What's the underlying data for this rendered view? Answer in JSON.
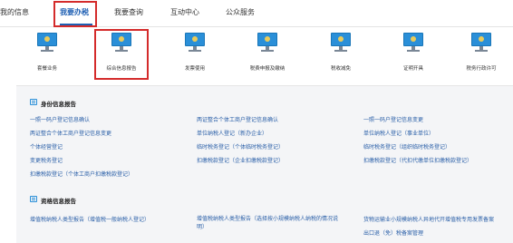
{
  "topnav": {
    "tabs": [
      "我的信息",
      "我要办税",
      "我要查询",
      "互动中心",
      "公众服务"
    ]
  },
  "icons": [
    "套餐业务",
    "综合信息报告",
    "发票使用",
    "税费申报及缴纳",
    "税收减免",
    "证明开具",
    "税务行政许可"
  ],
  "sections": {
    "identity": {
      "title": "身份信息报告",
      "links": [
        "一照一码户登记信息确认",
        "两证整合个体工商户登记信息确认",
        "一照一码户登记信息变更",
        "两证整合个体工商户登记信息变更",
        "单位纳税人登记（新办企业）",
        "单位纳税人登记（事业单位）",
        "个体经营登记",
        "临时税务登记（个体临时税务登记）",
        "临时税务登记（组织临时税务登记）",
        "变更税务登记",
        "扣缴税款登记（企业扣缴税款登记）",
        "扣缴税款登记（代扣代缴单位扣缴税款登记）",
        "扣缴税款登记（个体工商户扣缴税款登记）"
      ]
    },
    "qualification": {
      "title": "资格信息报告",
      "links": [
        "增值税纳税人类型报告（增值税一般纳税人登记）",
        "增值税纳税人类型报告（选择按小规模纳税人纳税的情况说明）",
        "货物运输业小规模纳税人异地代开增值税专用发票备案",
        "出口退（免）税备案管理"
      ]
    }
  },
  "colors": {
    "accent": "#1e5fb3",
    "highlight": "#d42b2b",
    "link": "#2a5fa8",
    "icon": "#2a8fd8",
    "panel_bg": "#f4f5f7"
  }
}
